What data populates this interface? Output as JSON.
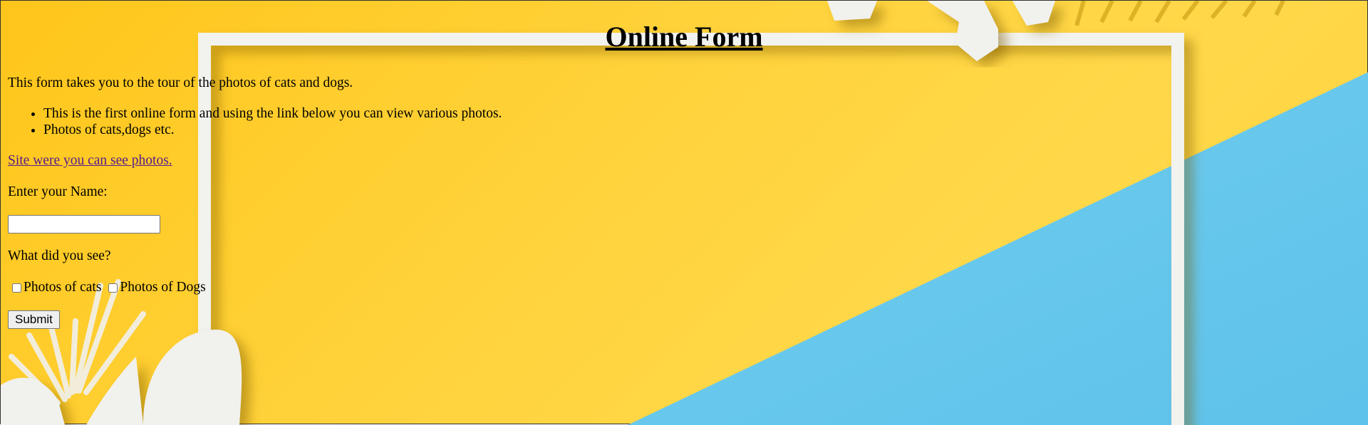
{
  "page": {
    "title": "Online Form",
    "intro": "This form takes you to the tour of the photos of cats and dogs.",
    "bullets": [
      "This is the first online form and using the link below you can view various photos.",
      "Photos of cats,dogs etc."
    ],
    "link_text": "Site were you can see photos."
  },
  "form": {
    "name_label": "Enter your Name:",
    "name_value": "",
    "question": "What did you see?",
    "options": [
      {
        "label": "Photos of cats",
        "checked": false
      },
      {
        "label": "Photos of Dogs",
        "checked": false
      }
    ],
    "submit_label": "Submit"
  },
  "colors": {
    "background_yellow": "#ffd23a",
    "background_blue": "#6ac8ec",
    "frame_white": "#f2f2ee",
    "link_visited": "#551a8b"
  }
}
